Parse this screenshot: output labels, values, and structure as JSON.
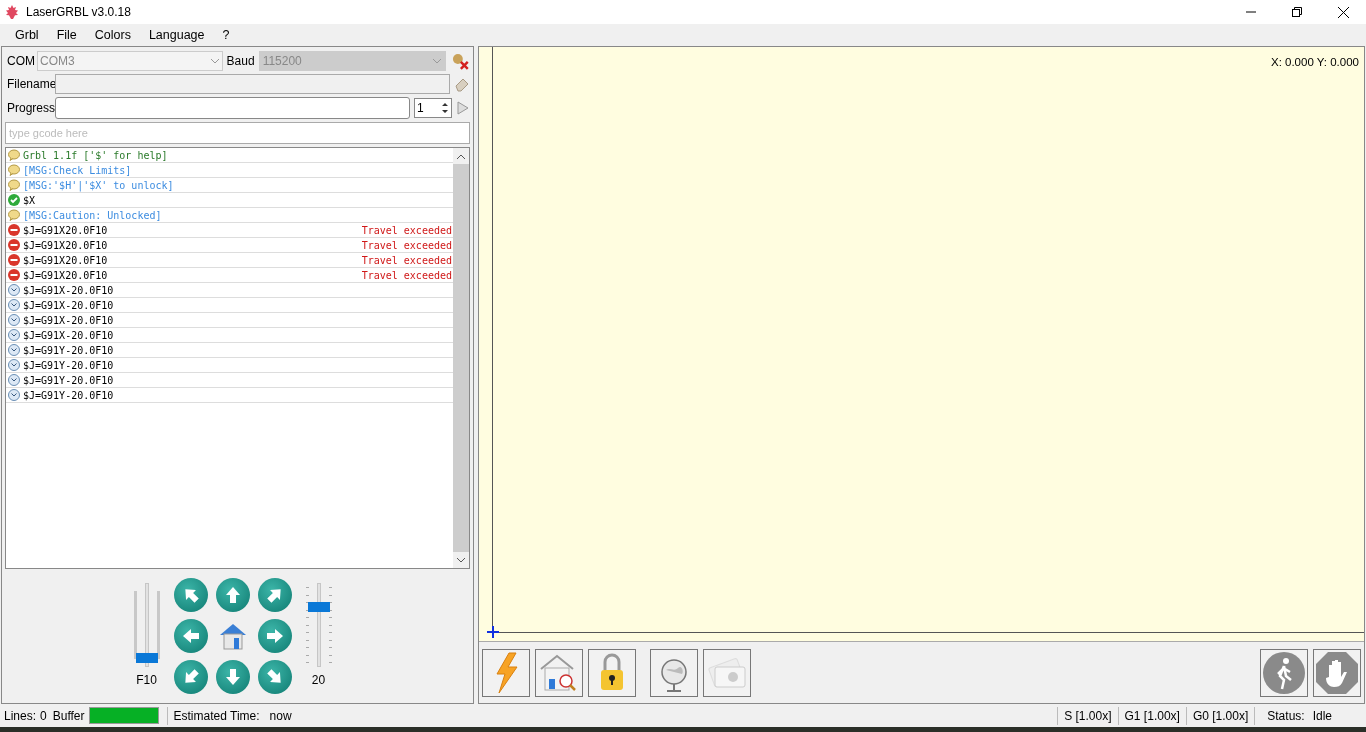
{
  "window": {
    "title": "LaserGRBL v3.0.18"
  },
  "menu": [
    "Grbl",
    "File",
    "Colors",
    "Language",
    "?"
  ],
  "connection": {
    "com_label": "COM",
    "com_value": "COM3",
    "baud_label": "Baud",
    "baud_value": "115200"
  },
  "filename": {
    "label": "Filename"
  },
  "progress": {
    "label": "Progress",
    "level": 0,
    "copies": "1"
  },
  "gcode_input": {
    "placeholder": "type gcode here"
  },
  "log": [
    {
      "kind": "info",
      "text": "Grbl 1.1f ['$' for help]"
    },
    {
      "kind": "message",
      "text": "[MSG:Check Limits]"
    },
    {
      "kind": "message",
      "text": "[MSG:'$H'|'$X' to unlock]"
    },
    {
      "kind": "ok",
      "text": "$X"
    },
    {
      "kind": "message",
      "text": "[MSG:Caution: Unlocked]"
    },
    {
      "kind": "error",
      "text": "$J=G91X20.0F10",
      "result": "Travel exceeded"
    },
    {
      "kind": "error",
      "text": "$J=G91X20.0F10",
      "result": "Travel exceeded"
    },
    {
      "kind": "error",
      "text": "$J=G91X20.0F10",
      "result": "Travel exceeded"
    },
    {
      "kind": "error",
      "text": "$J=G91X20.0F10",
      "result": "Travel exceeded"
    },
    {
      "kind": "pending",
      "text": "$J=G91X-20.0F10"
    },
    {
      "kind": "pending",
      "text": "$J=G91X-20.0F10"
    },
    {
      "kind": "pending",
      "text": "$J=G91X-20.0F10"
    },
    {
      "kind": "pending",
      "text": "$J=G91X-20.0F10"
    },
    {
      "kind": "pending",
      "text": "$J=G91Y-20.0F10"
    },
    {
      "kind": "pending",
      "text": "$J=G91Y-20.0F10"
    },
    {
      "kind": "pending",
      "text": "$J=G91Y-20.0F10"
    },
    {
      "kind": "pending",
      "text": "$J=G91Y-20.0F10"
    }
  ],
  "jog": {
    "speed_slider": {
      "level": 0.05,
      "label": "F10"
    },
    "step_slider": {
      "level": 0.75,
      "label": "20"
    }
  },
  "canvas": {
    "coordinates": "X: 0.000 Y: 0.000"
  },
  "status_bar": {
    "lines_label": "Lines:",
    "lines_value": "0",
    "buffer_label": "Buffer",
    "buffer": {
      "level": 1
    },
    "time_label": "Estimated Time:",
    "time_value": "now",
    "overrides": [
      "S [1.00x]",
      "G1 [1.00x]",
      "G0 [1.00x]"
    ],
    "status_label": "Status:",
    "status_value": "Idle"
  }
}
